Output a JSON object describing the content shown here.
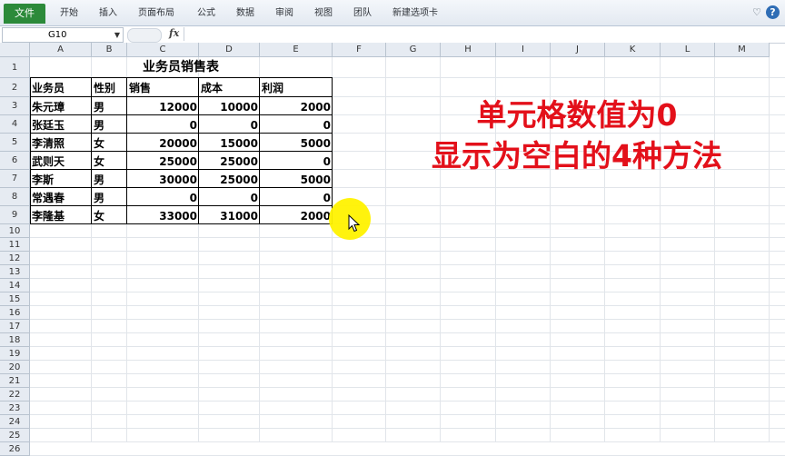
{
  "ribbon": {
    "file_tab": "文件",
    "tabs": [
      "开始",
      "插入",
      "页面布局",
      "公式",
      "数据",
      "审阅",
      "视图",
      "团队",
      "新建选项卡"
    ]
  },
  "formula_bar": {
    "name_box": "G10",
    "formula": ""
  },
  "columns": [
    "A",
    "B",
    "C",
    "D",
    "E",
    "F",
    "G",
    "H",
    "I",
    "J",
    "K",
    "L",
    "M"
  ],
  "rows": [
    "1",
    "2",
    "3",
    "4",
    "5",
    "6",
    "7",
    "8",
    "9",
    "10",
    "11",
    "12",
    "13",
    "14",
    "15",
    "16",
    "17",
    "18",
    "19",
    "20",
    "21",
    "22",
    "23",
    "24",
    "25",
    "26"
  ],
  "sheet": {
    "title": "业务员销售表",
    "headers": [
      "业务员",
      "性别",
      "销售",
      "成本",
      "利润"
    ],
    "records": [
      [
        "朱元璋",
        "男",
        "12000",
        "10000",
        "2000"
      ],
      [
        "张廷玉",
        "男",
        "0",
        "0",
        "0"
      ],
      [
        "李清照",
        "女",
        "20000",
        "15000",
        "5000"
      ],
      [
        "武则天",
        "女",
        "25000",
        "25000",
        "0"
      ],
      [
        "李斯",
        "男",
        "30000",
        "25000",
        "5000"
      ],
      [
        "常遇春",
        "男",
        "0",
        "0",
        "0"
      ],
      [
        "李隆基",
        "女",
        "33000",
        "31000",
        "2000"
      ]
    ]
  },
  "overlay": {
    "line1": "单元格数值为0",
    "line2": "显示为空白的4种方法"
  },
  "colors": {
    "accent_file_tab": "#2c8a3a",
    "overlay_text": "#e3101a",
    "highlight_spot": "#fff200"
  }
}
